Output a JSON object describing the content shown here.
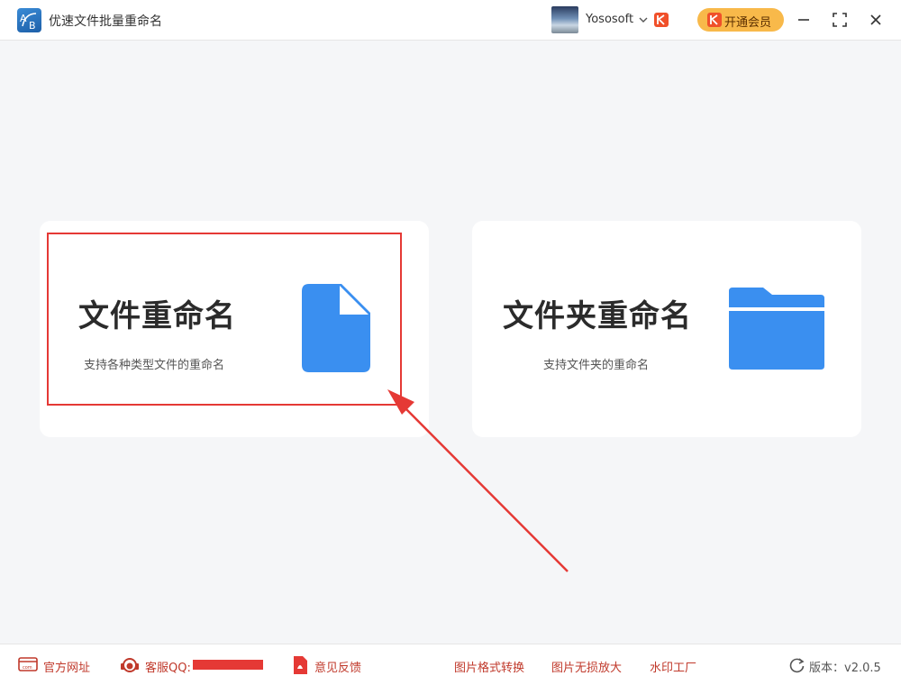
{
  "app": {
    "title": "优速文件批量重命名",
    "logo_text": "AB"
  },
  "user": {
    "name": "Yososoft"
  },
  "header": {
    "vip_button_label": "开通会员"
  },
  "cards": [
    {
      "title": "文件重命名",
      "subtitle": "支持各种类型文件的重命名",
      "icon": "file-icon"
    },
    {
      "title": "文件夹重命名",
      "subtitle": "支持文件夹的重命名",
      "icon": "folder-icon"
    }
  ],
  "footer": {
    "official_site": "官方网址",
    "service_qq": "客服QQ:",
    "feedback": "意见反馈",
    "links": [
      "图片格式转换",
      "图片无损放大",
      "水印工厂"
    ],
    "version_label": "版本：",
    "version_value": "v2.0.5"
  },
  "colors": {
    "accent_blue": "#3a8ff0",
    "highlight_red": "#e53935",
    "vip_gold": "#f8b94a",
    "footer_link_red": "#c0392b"
  }
}
